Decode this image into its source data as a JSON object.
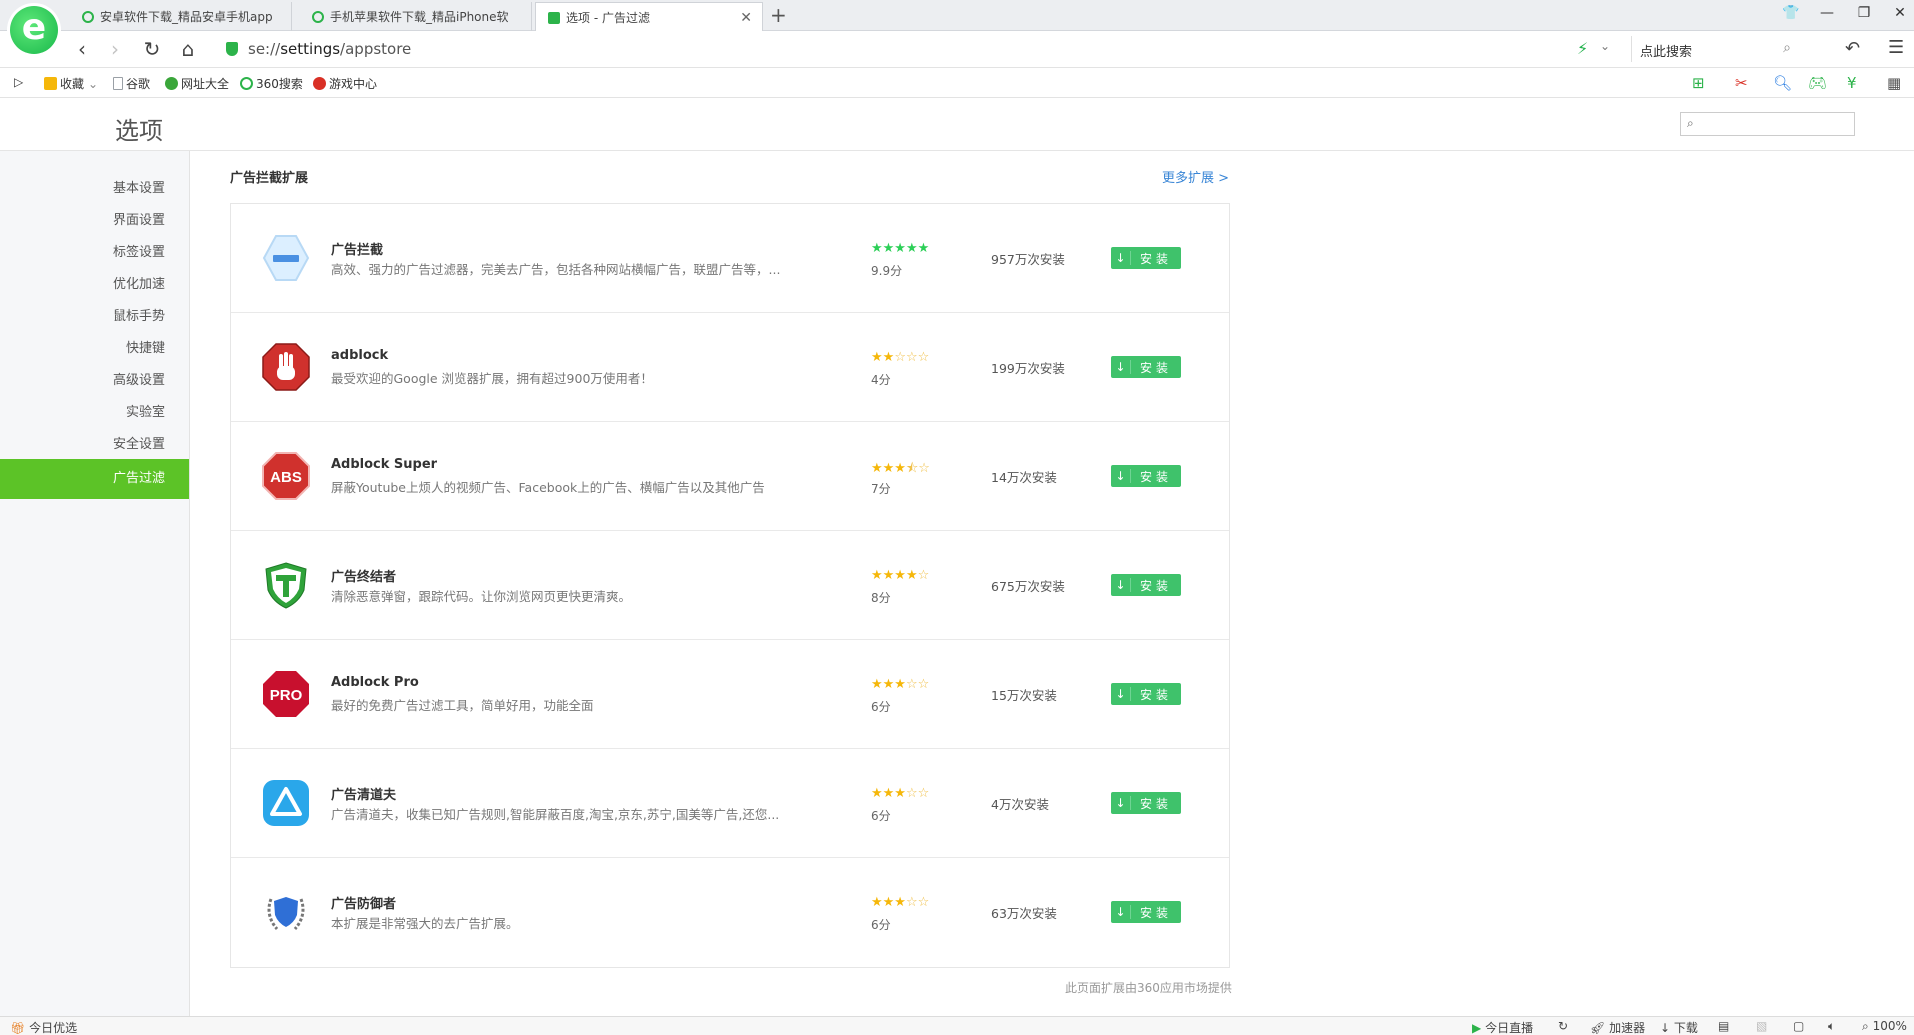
{
  "browser": {
    "logo_letter": "e",
    "tabs": [
      {
        "title": "安卓软件下载_精品安卓手机app"
      },
      {
        "title": "手机苹果软件下载_精品iPhone软"
      },
      {
        "title": "选项 - 广告过滤"
      }
    ],
    "new_tab": "+",
    "address": {
      "scheme": "se://",
      "host": "settings",
      "path": "/appstore"
    },
    "search_placeholder": "点此搜索"
  },
  "bookmarks": [
    {
      "label": "收藏",
      "color": "#f5b70a"
    },
    {
      "label": "谷歌",
      "color": "#9aa0a6"
    },
    {
      "label": "网址大全",
      "color": "#3aa63a"
    },
    {
      "label": "360搜索",
      "color": "#2cb34a"
    },
    {
      "label": "游戏中心",
      "color": "#d93025"
    }
  ],
  "page": {
    "title": "选项",
    "search_value": ""
  },
  "sidebar": {
    "items": [
      {
        "label": "基本设置"
      },
      {
        "label": "界面设置"
      },
      {
        "label": "标签设置"
      },
      {
        "label": "优化加速"
      },
      {
        "label": "鼠标手势"
      },
      {
        "label": "快捷键"
      },
      {
        "label": "高级设置"
      },
      {
        "label": "实验室"
      },
      {
        "label": "安全设置"
      },
      {
        "label": "广告过滤"
      }
    ],
    "active": "广告过滤"
  },
  "content": {
    "section_title": "广告拦截扩展",
    "more_link": "更多扩展 >",
    "install_label": "安装",
    "footnote": "此页面扩展由360应用市场提供",
    "extensions": [
      {
        "name": "广告拦截",
        "desc": "高效、强力的广告过滤器，完美去广告，包括各种网站横幅广告，联盟广告等，...",
        "rating": 5,
        "score": "9.9分",
        "installs": "957万次安装",
        "icon": "minus-hexagon-icon",
        "color": "#4a90e2"
      },
      {
        "name": "adblock",
        "desc": "最受欢迎的Google 浏览器扩展，拥有超过900万使用者！",
        "rating": 2,
        "score": "4分",
        "installs": "199万次安装",
        "icon": "stop-hand-icon",
        "color": "#d0312d"
      },
      {
        "name": "Adblock Super",
        "desc": "屏蔽Youtube上烦人的视频广告、Facebook上的广告、横幅广告以及其他广告",
        "rating": 3.5,
        "score": "7分",
        "installs": "14万次安装",
        "icon": "abs-icon",
        "color": "#d0312d"
      },
      {
        "name": "广告终结者",
        "desc": "清除恶意弹窗，跟踪代码。让你浏览网页更快更清爽。",
        "rating": 4,
        "score": "8分",
        "installs": "675万次安装",
        "icon": "shield-t-icon",
        "color": "#2fa33a"
      },
      {
        "name": "Adblock Pro",
        "desc": "最好的免费广告过滤工具，简单好用，功能全面",
        "rating": 3,
        "score": "6分",
        "installs": "15万次安装",
        "icon": "pro-octagon-icon",
        "color": "#c8102e"
      },
      {
        "name": "广告清道夫",
        "desc": "广告清道夫，收集已知广告规则,智能屏蔽百度,淘宝,京东,苏宁,国美等广告,还您...",
        "rating": 3,
        "score": "6分",
        "installs": "4万次安装",
        "icon": "triangle-app-icon",
        "color": "#2aa7ea"
      },
      {
        "name": "广告防御者",
        "desc": "本扩展是非常强大的去广告扩展。",
        "rating": 3,
        "score": "6分",
        "installs": "63万次安装",
        "icon": "laurel-shield-icon",
        "color": "#2f6fd6"
      }
    ]
  },
  "statusbar": {
    "left": "今日优选",
    "items": [
      "今日直播",
      "加速器",
      "下载",
      "100%"
    ]
  }
}
